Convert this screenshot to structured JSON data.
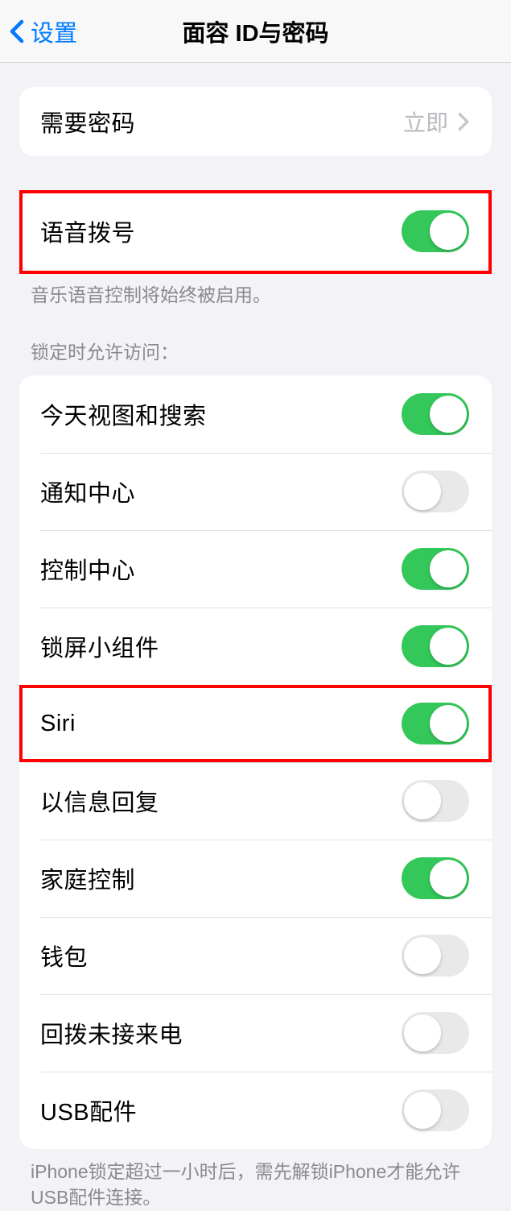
{
  "header": {
    "back_label": "设置",
    "title": "面容 ID与密码"
  },
  "passcode": {
    "label": "需要密码",
    "value": "立即"
  },
  "voice_dial": {
    "label": "语音拨号",
    "on": true,
    "footer": "音乐语音控制将始终被启用。"
  },
  "locked_access": {
    "header": "锁定时允许访问：",
    "items": [
      {
        "label": "今天视图和搜索",
        "on": true
      },
      {
        "label": "通知中心",
        "on": false
      },
      {
        "label": "控制中心",
        "on": true
      },
      {
        "label": "锁屏小组件",
        "on": true
      },
      {
        "label": "Siri",
        "on": true
      },
      {
        "label": "以信息回复",
        "on": false
      },
      {
        "label": "家庭控制",
        "on": true
      },
      {
        "label": "钱包",
        "on": false
      },
      {
        "label": "回拨未接来电",
        "on": false
      },
      {
        "label": "USB配件",
        "on": false
      }
    ],
    "footer": "iPhone锁定超过一小时后，需先解锁iPhone才能允许USB配件连接。"
  }
}
